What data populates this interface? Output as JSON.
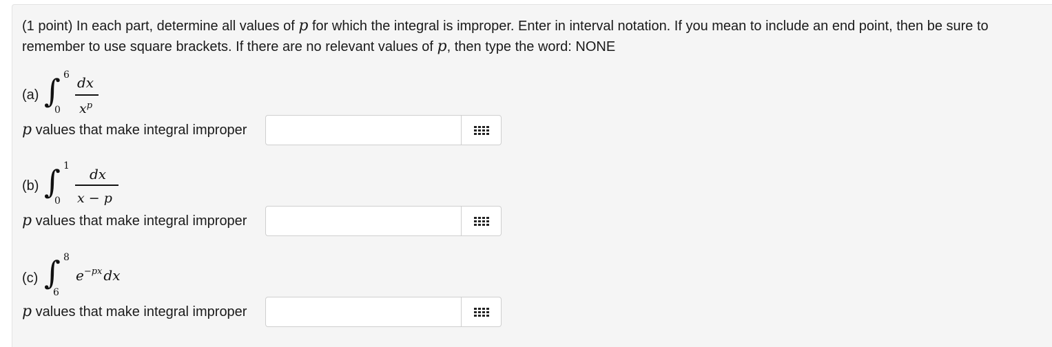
{
  "problem": {
    "intro_before_p1": "(1 point) In each part, determine all values of ",
    "var": "p",
    "intro_between": " for which the integral is improper. Enter in interval notation. If you mean to include an end point, then be sure to remember to use square brackets. If there are no relevant values of ",
    "intro_after_p2": ", then type the word: NONE"
  },
  "parts": [
    {
      "label": "(a)",
      "upper": "6",
      "lower": "0",
      "numerator": "dx",
      "denominator": "x",
      "denominator_sup": "p",
      "prompt_var": "p",
      "prompt": " values that make integral improper",
      "value": "",
      "palette_icon": "grid-icon"
    },
    {
      "label": "(b)",
      "upper": "1",
      "lower": "0",
      "numerator": "dx",
      "denominator": "x − p",
      "prompt_var": "p",
      "prompt": " values that make integral improper",
      "value": "",
      "palette_icon": "grid-icon"
    },
    {
      "label": "(c)",
      "upper": "8",
      "lower": "6",
      "integrand_base": "e",
      "integrand_sup": "−px",
      "integrand_tail": "dx",
      "prompt_var": "p",
      "prompt": " values that make integral improper",
      "value": "",
      "palette_icon": "grid-icon"
    }
  ]
}
